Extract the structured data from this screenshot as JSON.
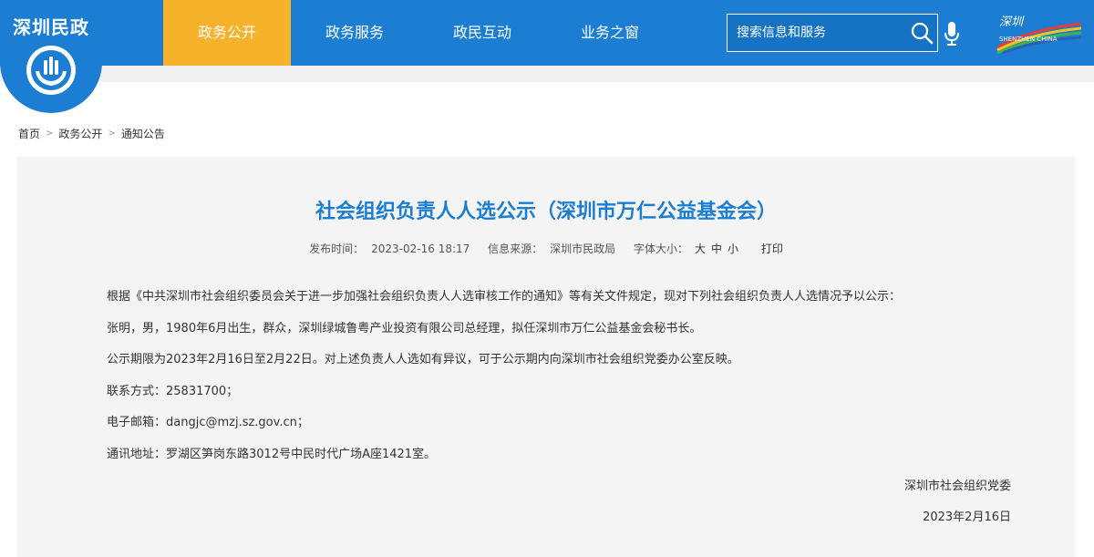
{
  "header": {
    "logo_text": "深圳民政",
    "nav": [
      "政务公开",
      "政务服务",
      "政民互动",
      "业务之窗"
    ],
    "active_index": 0,
    "search_placeholder": "搜索信息和服务",
    "city_logo_text": "深圳",
    "city_logo_sub": "SHENZHEN CHINA"
  },
  "breadcrumb": [
    "首页",
    "政务公开",
    "通知公告"
  ],
  "article": {
    "title": "社会组织负责人人选公示（深圳市万仁公益基金会）",
    "publish_label": "发布时间：",
    "publish_time": "2023-02-16 18:17",
    "source_label": "信息来源：",
    "source": "深圳市民政局",
    "font_size_label": "字体大小：",
    "font_sizes": [
      "大",
      "中",
      "小"
    ],
    "print_label": "打印",
    "paragraphs": [
      "根据《中共深圳市社会组织委员会关于进一步加强社会组织负责人人选审核工作的通知》等有关文件规定，现对下列社会组织负责人人选情况予以公示：",
      "张明，男，1980年6月出生，群众，深圳绿城鲁粤产业投资有限公司总经理，拟任深圳市万仁公益基金会秘书长。",
      "公示期限为2023年2月16日至2月22日。对上述负责人人选如有异议，可于公示期内向深圳市社会组织党委办公室反映。",
      "联系方式：25831700；",
      "电子邮箱：dangjc@mzj.sz.gov.cn；",
      "通讯地址：罗湖区笋岗东路3012号中民时代广场A座1421室。"
    ],
    "signature_org": "深圳市社会组织党委",
    "signature_date": "2023年2月16日"
  },
  "colors": {
    "primary": "#1b7ed2",
    "active_nav": "#f7b22b",
    "content_bg": "#f4f4f4"
  }
}
